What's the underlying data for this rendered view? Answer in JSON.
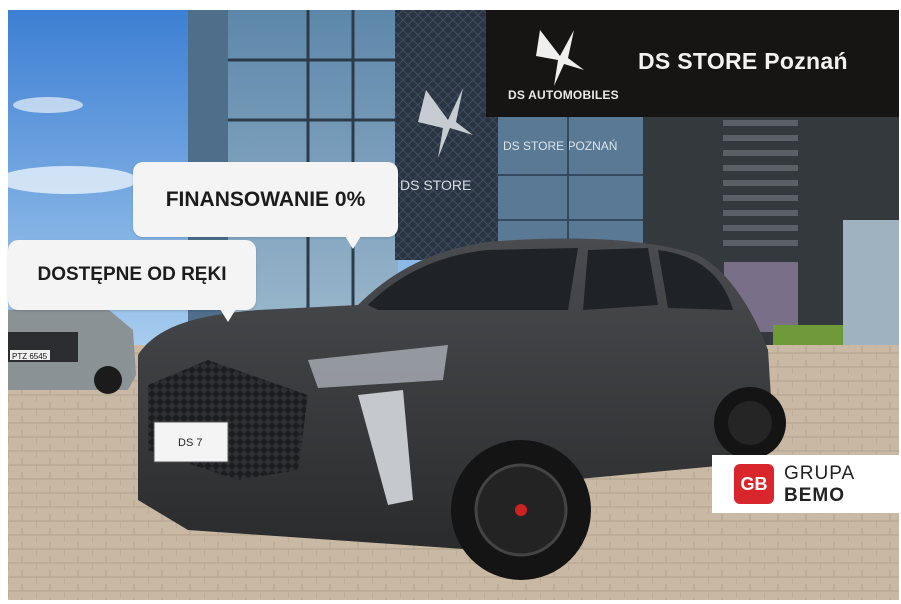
{
  "photo": {
    "description_icon": "car-dealership-photo",
    "building_sign_main": "DS STORE",
    "building_sign_glass": "DS STORE POZNAŃ",
    "plate_front": "DS 7",
    "plate_left_car": "PTZ 6545"
  },
  "banner": {
    "subtitle": "DS AUTOMOBILES",
    "title": "DS STORE Poznań",
    "bg_color": "#161514"
  },
  "bubbles": {
    "financing": "FINANSOWANIE 0%",
    "available": "DOSTĘPNE OD RĘKI"
  },
  "partner": {
    "mark": "GB",
    "line1": "GRUPA",
    "line2": "BEMO",
    "accent": "#d9262c"
  }
}
